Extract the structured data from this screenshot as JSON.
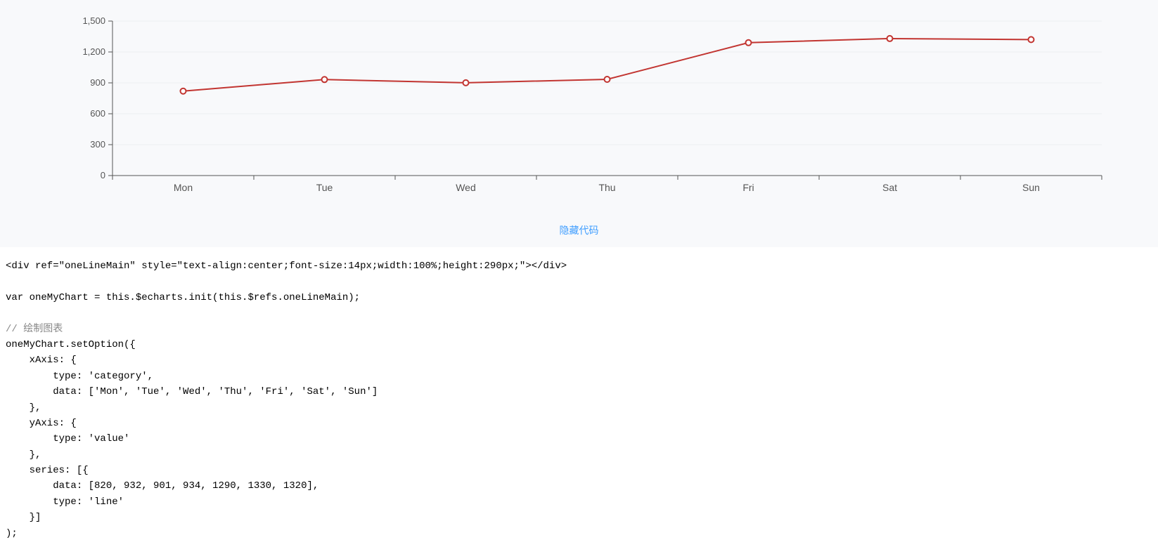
{
  "chart_data": {
    "type": "line",
    "categories": [
      "Mon",
      "Tue",
      "Wed",
      "Thu",
      "Fri",
      "Sat",
      "Sun"
    ],
    "values": [
      820,
      932,
      901,
      934,
      1290,
      1330,
      1320
    ],
    "y_ticks": [
      0,
      300,
      600,
      900,
      1200,
      1500
    ],
    "y_tick_labels": [
      "0",
      "300",
      "600",
      "900",
      "1,200",
      "1,500"
    ],
    "ylim": [
      0,
      1500
    ],
    "title": "",
    "xlabel": "",
    "ylabel": ""
  },
  "link": {
    "label": "隐藏代码"
  },
  "code": {
    "line1": "<div ref=\"oneLineMain\" style=\"text-align:center;font-size:14px;width:100%;height:290px;\"></div>",
    "blank1": "",
    "line2": "var oneMyChart = this.$echarts.init(this.$refs.oneLineMain);",
    "blank2": "",
    "comment": "// 绘制图表",
    "line3": "oneMyChart.setOption({",
    "line4": "    xAxis: {",
    "line5": "        type: 'category',",
    "line6": "        data: ['Mon', 'Tue', 'Wed', 'Thu', 'Fri', 'Sat', 'Sun']",
    "line7": "    },",
    "line8": "    yAxis: {",
    "line9": "        type: 'value'",
    "line10": "    },",
    "line11": "    series: [{",
    "line12": "        data: [820, 932, 901, 934, 1290, 1330, 1320],",
    "line13": "        type: 'line'",
    "line14": "    }]",
    "line15": ");"
  }
}
